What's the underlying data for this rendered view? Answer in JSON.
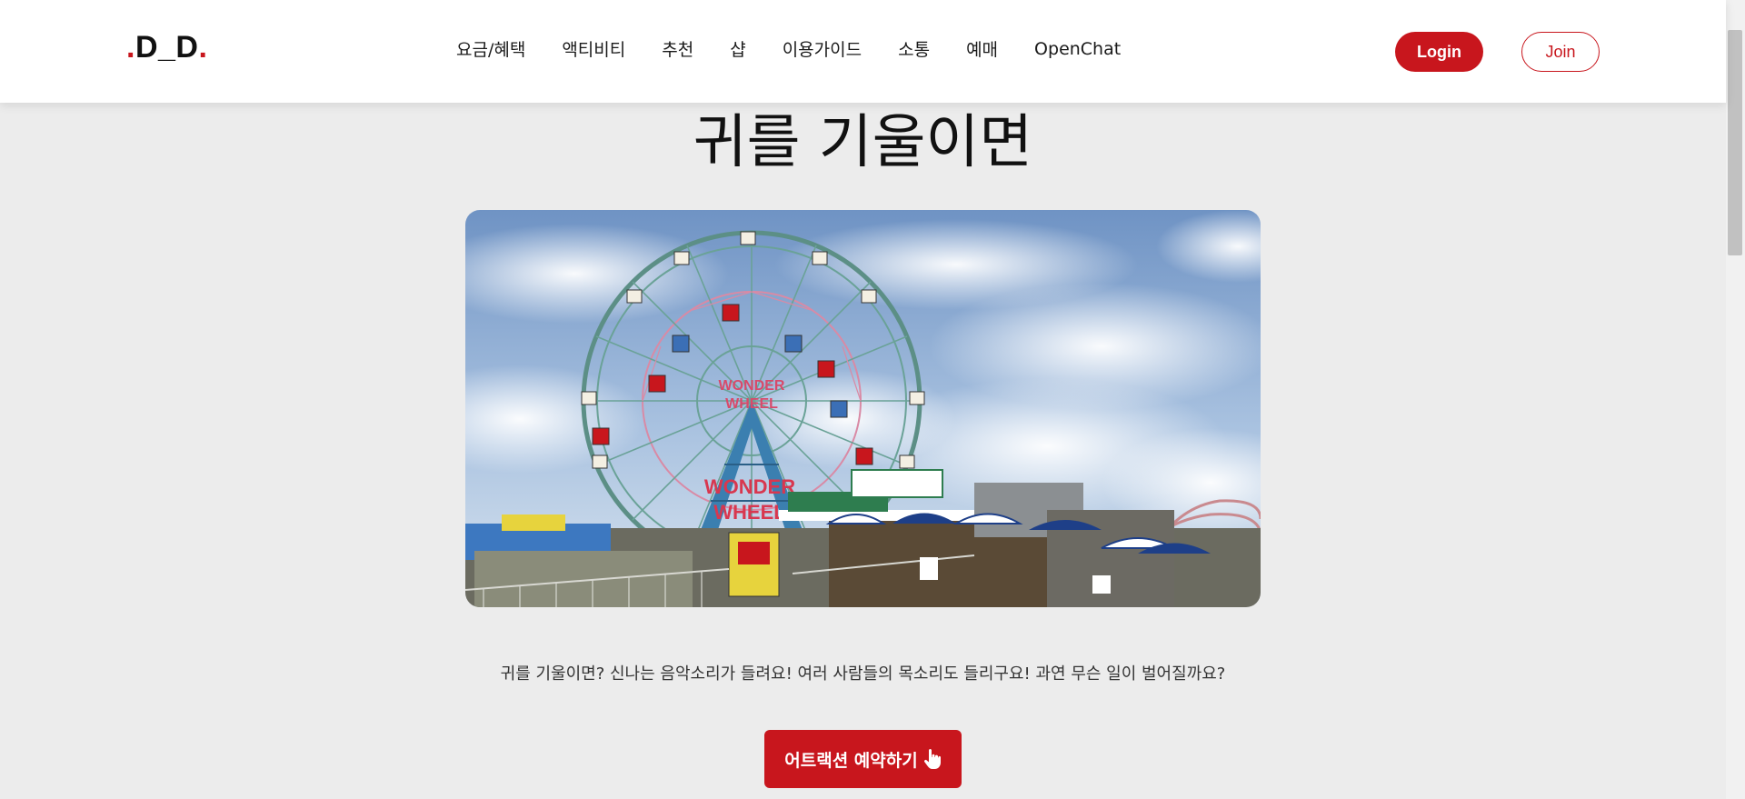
{
  "header": {
    "logo": {
      "dot_left": ".",
      "text": "D_D",
      "dot_right": "."
    },
    "nav": [
      {
        "label": "요금/혜택"
      },
      {
        "label": "액티비티"
      },
      {
        "label": "추천"
      },
      {
        "label": "샵"
      },
      {
        "label": "이용가이드"
      },
      {
        "label": "소통"
      },
      {
        "label": "예매"
      },
      {
        "label": "OpenChat"
      }
    ],
    "login_label": "Login",
    "join_label": "Join"
  },
  "main": {
    "title": "귀를 기울이면",
    "hero_image": {
      "signs": [
        "WONDER",
        "WHEEL",
        "WONDER",
        "WHEEL"
      ]
    },
    "description": "귀를 기울이면? 신나는 음악소리가 들려요! 여러 사람들의 목소리도 들리구요! 과연 무슨 일이 벌어질까요?",
    "cta_label": "어트랙션 예약하기",
    "cta_icon": "pointing-hand-icon"
  },
  "colors": {
    "accent": "#c8161d",
    "background": "#ececec",
    "header_bg": "#ffffff",
    "text": "#111111"
  }
}
